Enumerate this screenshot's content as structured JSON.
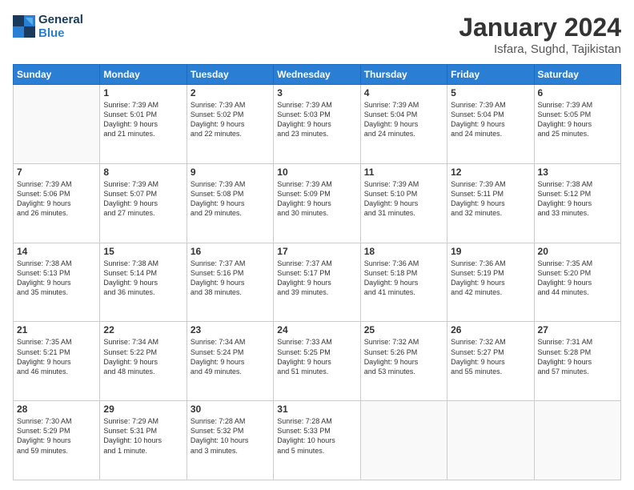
{
  "logo": {
    "line1": "General",
    "line2": "Blue"
  },
  "title": "January 2024",
  "location": "Isfara, Sughd, Tajikistan",
  "weekdays": [
    "Sunday",
    "Monday",
    "Tuesday",
    "Wednesday",
    "Thursday",
    "Friday",
    "Saturday"
  ],
  "weeks": [
    [
      {
        "day": "",
        "info": ""
      },
      {
        "day": "1",
        "info": "Sunrise: 7:39 AM\nSunset: 5:01 PM\nDaylight: 9 hours\nand 21 minutes."
      },
      {
        "day": "2",
        "info": "Sunrise: 7:39 AM\nSunset: 5:02 PM\nDaylight: 9 hours\nand 22 minutes."
      },
      {
        "day": "3",
        "info": "Sunrise: 7:39 AM\nSunset: 5:03 PM\nDaylight: 9 hours\nand 23 minutes."
      },
      {
        "day": "4",
        "info": "Sunrise: 7:39 AM\nSunset: 5:04 PM\nDaylight: 9 hours\nand 24 minutes."
      },
      {
        "day": "5",
        "info": "Sunrise: 7:39 AM\nSunset: 5:04 PM\nDaylight: 9 hours\nand 24 minutes."
      },
      {
        "day": "6",
        "info": "Sunrise: 7:39 AM\nSunset: 5:05 PM\nDaylight: 9 hours\nand 25 minutes."
      }
    ],
    [
      {
        "day": "7",
        "info": "Sunrise: 7:39 AM\nSunset: 5:06 PM\nDaylight: 9 hours\nand 26 minutes."
      },
      {
        "day": "8",
        "info": "Sunrise: 7:39 AM\nSunset: 5:07 PM\nDaylight: 9 hours\nand 27 minutes."
      },
      {
        "day": "9",
        "info": "Sunrise: 7:39 AM\nSunset: 5:08 PM\nDaylight: 9 hours\nand 29 minutes."
      },
      {
        "day": "10",
        "info": "Sunrise: 7:39 AM\nSunset: 5:09 PM\nDaylight: 9 hours\nand 30 minutes."
      },
      {
        "day": "11",
        "info": "Sunrise: 7:39 AM\nSunset: 5:10 PM\nDaylight: 9 hours\nand 31 minutes."
      },
      {
        "day": "12",
        "info": "Sunrise: 7:39 AM\nSunset: 5:11 PM\nDaylight: 9 hours\nand 32 minutes."
      },
      {
        "day": "13",
        "info": "Sunrise: 7:38 AM\nSunset: 5:12 PM\nDaylight: 9 hours\nand 33 minutes."
      }
    ],
    [
      {
        "day": "14",
        "info": "Sunrise: 7:38 AM\nSunset: 5:13 PM\nDaylight: 9 hours\nand 35 minutes."
      },
      {
        "day": "15",
        "info": "Sunrise: 7:38 AM\nSunset: 5:14 PM\nDaylight: 9 hours\nand 36 minutes."
      },
      {
        "day": "16",
        "info": "Sunrise: 7:37 AM\nSunset: 5:16 PM\nDaylight: 9 hours\nand 38 minutes."
      },
      {
        "day": "17",
        "info": "Sunrise: 7:37 AM\nSunset: 5:17 PM\nDaylight: 9 hours\nand 39 minutes."
      },
      {
        "day": "18",
        "info": "Sunrise: 7:36 AM\nSunset: 5:18 PM\nDaylight: 9 hours\nand 41 minutes."
      },
      {
        "day": "19",
        "info": "Sunrise: 7:36 AM\nSunset: 5:19 PM\nDaylight: 9 hours\nand 42 minutes."
      },
      {
        "day": "20",
        "info": "Sunrise: 7:35 AM\nSunset: 5:20 PM\nDaylight: 9 hours\nand 44 minutes."
      }
    ],
    [
      {
        "day": "21",
        "info": "Sunrise: 7:35 AM\nSunset: 5:21 PM\nDaylight: 9 hours\nand 46 minutes."
      },
      {
        "day": "22",
        "info": "Sunrise: 7:34 AM\nSunset: 5:22 PM\nDaylight: 9 hours\nand 48 minutes."
      },
      {
        "day": "23",
        "info": "Sunrise: 7:34 AM\nSunset: 5:24 PM\nDaylight: 9 hours\nand 49 minutes."
      },
      {
        "day": "24",
        "info": "Sunrise: 7:33 AM\nSunset: 5:25 PM\nDaylight: 9 hours\nand 51 minutes."
      },
      {
        "day": "25",
        "info": "Sunrise: 7:32 AM\nSunset: 5:26 PM\nDaylight: 9 hours\nand 53 minutes."
      },
      {
        "day": "26",
        "info": "Sunrise: 7:32 AM\nSunset: 5:27 PM\nDaylight: 9 hours\nand 55 minutes."
      },
      {
        "day": "27",
        "info": "Sunrise: 7:31 AM\nSunset: 5:28 PM\nDaylight: 9 hours\nand 57 minutes."
      }
    ],
    [
      {
        "day": "28",
        "info": "Sunrise: 7:30 AM\nSunset: 5:29 PM\nDaylight: 9 hours\nand 59 minutes."
      },
      {
        "day": "29",
        "info": "Sunrise: 7:29 AM\nSunset: 5:31 PM\nDaylight: 10 hours\nand 1 minute."
      },
      {
        "day": "30",
        "info": "Sunrise: 7:28 AM\nSunset: 5:32 PM\nDaylight: 10 hours\nand 3 minutes."
      },
      {
        "day": "31",
        "info": "Sunrise: 7:28 AM\nSunset: 5:33 PM\nDaylight: 10 hours\nand 5 minutes."
      },
      {
        "day": "",
        "info": ""
      },
      {
        "day": "",
        "info": ""
      },
      {
        "day": "",
        "info": ""
      }
    ]
  ]
}
